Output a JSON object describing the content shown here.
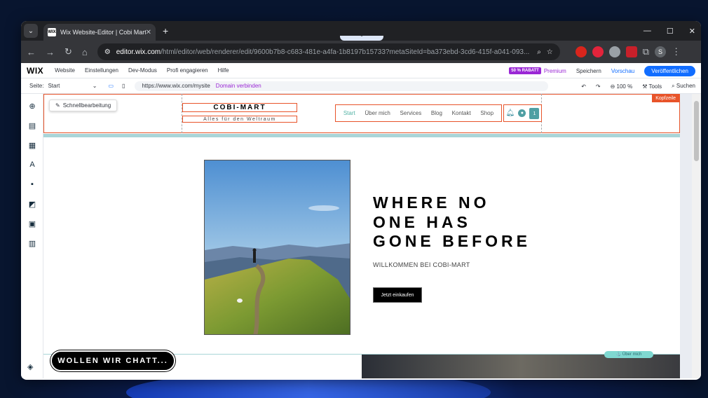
{
  "browser": {
    "tab_title": "Wix Website-Editor | Cobi Mart",
    "tab_favicon": "WIX",
    "url_host": "editor.wix.com",
    "url_path": "/html/editor/web/renderer/edit/9600b7b8-c683-481e-a4fa-1b8197b15733?metaSiteId=ba373ebd-3cd6-415f-a041-093...",
    "profile_initial": "S",
    "extension_colors": [
      "#d9251c",
      "#e3243b",
      "#9aa0a6",
      "#c8202a"
    ]
  },
  "wix_top": {
    "logo": "WIX",
    "menu": [
      "Website",
      "Einstellungen",
      "Dev-Modus",
      "Profi engagieren",
      "Hilfe"
    ],
    "rabatt_badge": "50 % RABATT",
    "premium": "Premium",
    "speichern": "Speichern",
    "vorschau": "Vorschau",
    "publish": "Veröffentlichen"
  },
  "wix_sub": {
    "page_label": "Seite:",
    "page_value": "Start",
    "site_url": "https://www.wix.com/mysite",
    "domain_link": "Domain verbinden",
    "zoom": "100 %",
    "tools": "Tools",
    "search": "Suchen"
  },
  "stage": {
    "quick_edit": "Schnellbearbeitung",
    "header_badge": "Kopfzeile",
    "brand_name": "COBI-MART",
    "brand_tagline": "Alles für den Weltraum",
    "nav": [
      "Start",
      "Über mich",
      "Services",
      "Blog",
      "Kontakt",
      "Shop"
    ],
    "cart_count": "1",
    "hero_title_lines": [
      "WHERE NO",
      "ONE HAS",
      "GONE BEFORE"
    ],
    "hero_subtitle": "WILLKOMMEN BEI COBI-MART",
    "shop_button": "Jetzt einkaufen",
    "chat_button": "WOLLEN WIR CHATT...",
    "section_tag": "Über mich"
  },
  "colors": {
    "wix_blue": "#116dff",
    "premium_purple": "#9a27d5",
    "selection_orange": "#e8542a",
    "accent_teal": "#53b3a5"
  }
}
